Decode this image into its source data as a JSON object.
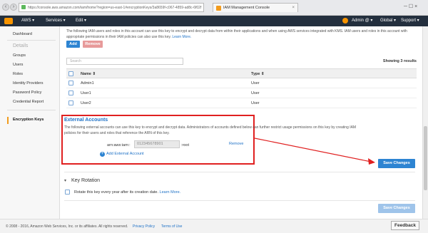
{
  "browser": {
    "url": "https://console.aws.amazon.com/iam/home?region=us-east-1#encryptionKeys/3a8659f-c067-4859-ad8c-6f02f",
    "tab_title": "IAM Management Console",
    "back_glyph": "‹",
    "forward_glyph": "›",
    "close_glyph": "×",
    "win_ctl": "─ ☐ ×"
  },
  "aws_nav": {
    "aws_label": "AWS ▾",
    "services_label": "Services ▾",
    "edit_label": "Edit ▾",
    "user_label": "Admin @ ▾",
    "region_label": "Global ▾",
    "support_label": "Support ▾"
  },
  "sidebar": {
    "dashboard": "Dashboard",
    "details_head": "Details",
    "items": [
      "Groups",
      "Users",
      "Roles",
      "Identity Providers",
      "Password Policy",
      "Credential Report"
    ],
    "encryption_keys": "Encryption Keys"
  },
  "intro": {
    "text": "The following IAM users and roles in this account can use this key to encrypt and decrypt data from within their applications and when using AWS services integrated with KMS. IAM users and roles in this account with appropriate permissions in their IAM policies can also use this key.",
    "learn_more": "Learn More."
  },
  "buttons": {
    "add": "Add",
    "remove": "Remove"
  },
  "search": {
    "placeholder": "Search"
  },
  "results": {
    "showing": "Showing 3 results"
  },
  "table": {
    "headers": {
      "name": "Name ⇕",
      "type": "Type ⇕"
    },
    "rows": [
      {
        "name": "Admin1",
        "type": "User"
      },
      {
        "name": "User1",
        "type": "User"
      },
      {
        "name": "User2",
        "type": "User"
      }
    ]
  },
  "external_accounts": {
    "title": "External Accounts",
    "description": "The following external accounts can use this key to encrypt and decrypt data. Administrators of accounts defined below can further restrict usage permissions on this key by creating IAM policies for their users and roles that reference the ARN of this key.",
    "arn_prefix": "arn:aws:iam::",
    "account_id": "012345678901",
    "arn_suffix": ":root",
    "remove": "Remove",
    "add_label": "Add External Account"
  },
  "save_changes": "Save Changes",
  "key_rotation": {
    "title": "Key Rotation",
    "text": "Rotate this key every year after its creation date.",
    "learn_more": "Learn More."
  },
  "footer": {
    "copyright": "© 2008 - 2016, Amazon Web Services, Inc. or its affiliates. All rights reserved.",
    "privacy": "Privacy Policy",
    "terms": "Terms of Use",
    "feedback": "Feedback"
  },
  "colors": {
    "highlight": "#e02020",
    "primary": "#2d84d2",
    "aws_bar": "#232f3e",
    "aws_orange": "#f79400"
  }
}
